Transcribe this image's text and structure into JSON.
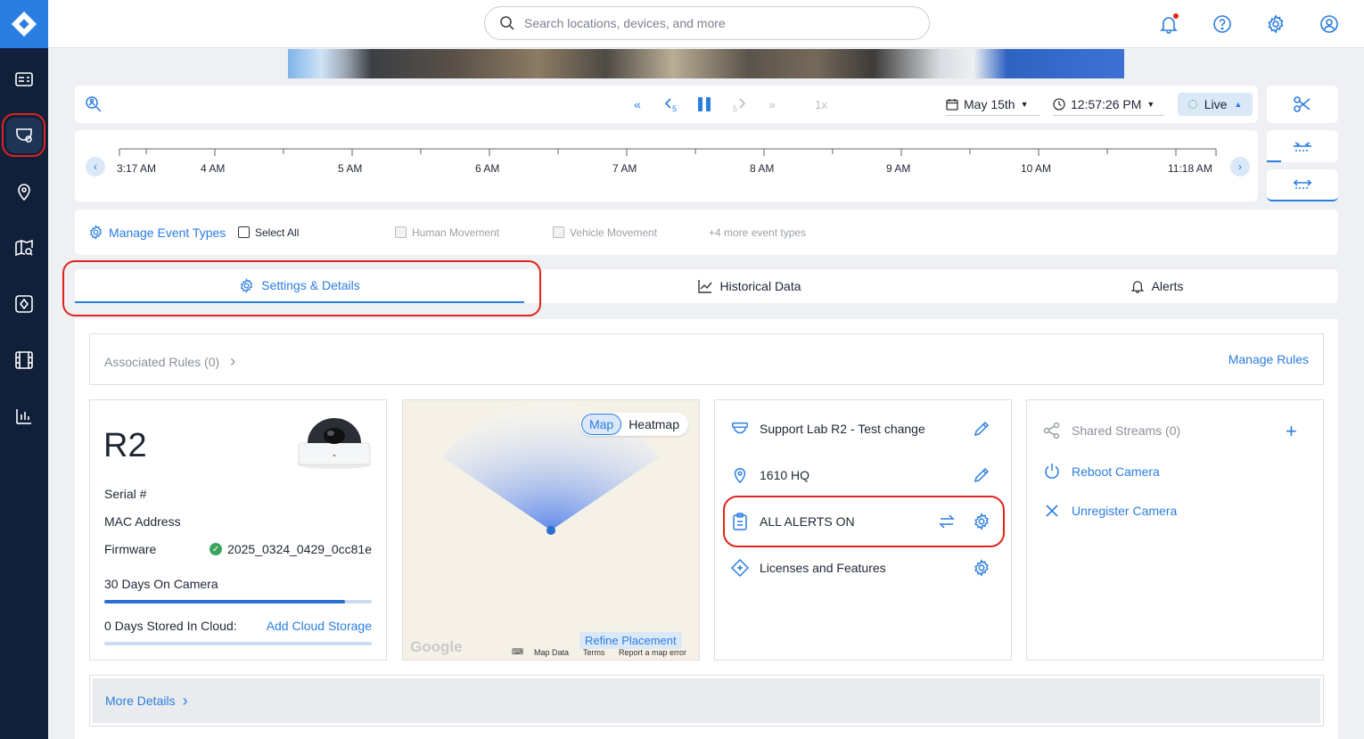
{
  "search": {
    "placeholder": "Search locations, devices, and more"
  },
  "playback": {
    "speed": "1x",
    "date": "May 15th",
    "time": "12:57:26 PM",
    "live": "Live"
  },
  "timeline": {
    "ticks": [
      "3:17 AM",
      "4 AM",
      "5 AM",
      "6 AM",
      "7 AM",
      "8 AM",
      "9 AM",
      "10 AM",
      "11:18 AM"
    ]
  },
  "events": {
    "manage": "Manage Event Types",
    "select_all": "Select All",
    "human": "Human Movement",
    "vehicle": "Vehicle Movement",
    "more": "+4 more event types"
  },
  "tabs": {
    "settings": "Settings & Details",
    "historical": "Historical Data",
    "alerts": "Alerts"
  },
  "rules": {
    "associated": "Associated Rules (0)",
    "manage": "Manage Rules"
  },
  "camera": {
    "name": "R2",
    "serial_label": "Serial #",
    "mac_label": "MAC Address",
    "firmware_label": "Firmware",
    "firmware_value": "2025_0324_0429_0cc81e",
    "days_on_camera": "30 Days On Camera",
    "days_on_camera_fraction": 0.9,
    "days_cloud": "0 Days Stored In Cloud:",
    "add_cloud": "Add Cloud Storage"
  },
  "map": {
    "toggle_map": "Map",
    "toggle_heatmap": "Heatmap",
    "refine": "Refine Placement",
    "google": "Google",
    "map_data": "Map Data",
    "terms": "Terms",
    "report": "Report a map error"
  },
  "details": {
    "name": "Support Lab R2 - Test change",
    "location": "1610 HQ",
    "alerts": "ALL ALERTS ON",
    "licenses": "Licenses and Features"
  },
  "streams": {
    "shared": "Shared Streams (0)",
    "reboot": "Reboot Camera",
    "unregister": "Unregister Camera"
  },
  "more_details": "More Details",
  "colors": {
    "accent": "#2a7de1",
    "sidebar": "#10203a",
    "highlight": "#e0231c"
  }
}
